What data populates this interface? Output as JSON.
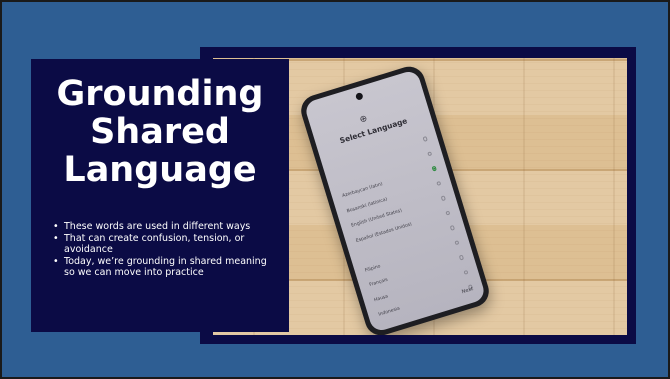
{
  "slide": {
    "title": "Grounding Shared Language",
    "bullets": [
      "These words are used in different ways",
      "That can create confusion, tension, or avoidance",
      "Today, we’re grounding in shared meaning so we can move into practice"
    ]
  },
  "phone_screen": {
    "title": "Select Language",
    "languages": [
      {
        "label": "",
        "selected": false
      },
      {
        "label": "",
        "selected": false
      },
      {
        "label": "Azerbaycan (latın)",
        "selected": true
      },
      {
        "label": "Bosanski (latinica)",
        "selected": false
      },
      {
        "label": "English (United States)",
        "selected": false
      },
      {
        "label": "Español (Estados Unidos)",
        "selected": false
      },
      {
        "label": "",
        "selected": false
      },
      {
        "label": "Filipino",
        "selected": false
      },
      {
        "label": "Français",
        "selected": false
      },
      {
        "label": "Hausa",
        "selected": false
      },
      {
        "label": "Indonesia",
        "selected": false
      }
    ],
    "next_label": "Next"
  },
  "colors": {
    "background": "#2e5e93",
    "panel": "#0b0b45",
    "text": "#ffffff",
    "radio_selected": "#2b8a3e"
  }
}
